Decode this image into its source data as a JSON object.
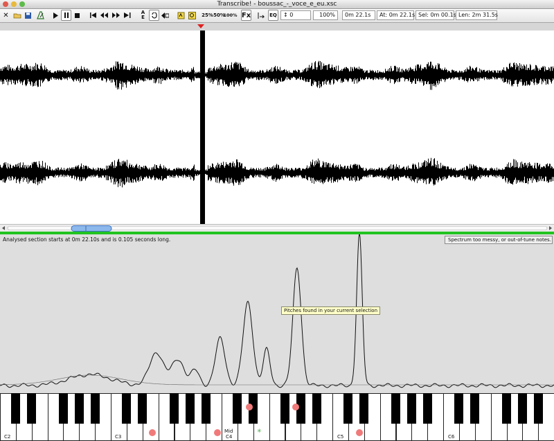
{
  "window": {
    "title": "Transcribe! - boussac_-_voce_e_eu.xsc"
  },
  "toolbar": {
    "speed_labels": [
      "25%",
      "50%",
      "100%"
    ],
    "fx_label": "Fx",
    "transpose_value": "0",
    "speed_value": "100%",
    "time_now": "0m 22.1s",
    "at": "At: 0m 22.1s",
    "sel": "Sel: 0m 00.1s",
    "len": "Len: 2m 31.5s",
    "icons": [
      "close-icon",
      "open-icon",
      "save-icon",
      "metronome-icon",
      "play-icon",
      "pause-icon",
      "stop-icon",
      "to-start-icon",
      "rewind-icon",
      "fast-forward-icon",
      "to-end-icon",
      "auto-icon",
      "loop-icon",
      "back-icon",
      "marker-icon",
      "zoom-icon",
      "eq-icon"
    ]
  },
  "analysis": {
    "info": "Analysed section starts at 0m 22.10s and is 0.105 seconds long.",
    "status": "Spectrum too messy, or out-of-tune notes.",
    "tooltip": "Pitches found in your current selection"
  },
  "keyboard": {
    "octave_labels": [
      "C2",
      "C3",
      "C4",
      "C5",
      "C6"
    ],
    "mid_label": "Mid"
  }
}
